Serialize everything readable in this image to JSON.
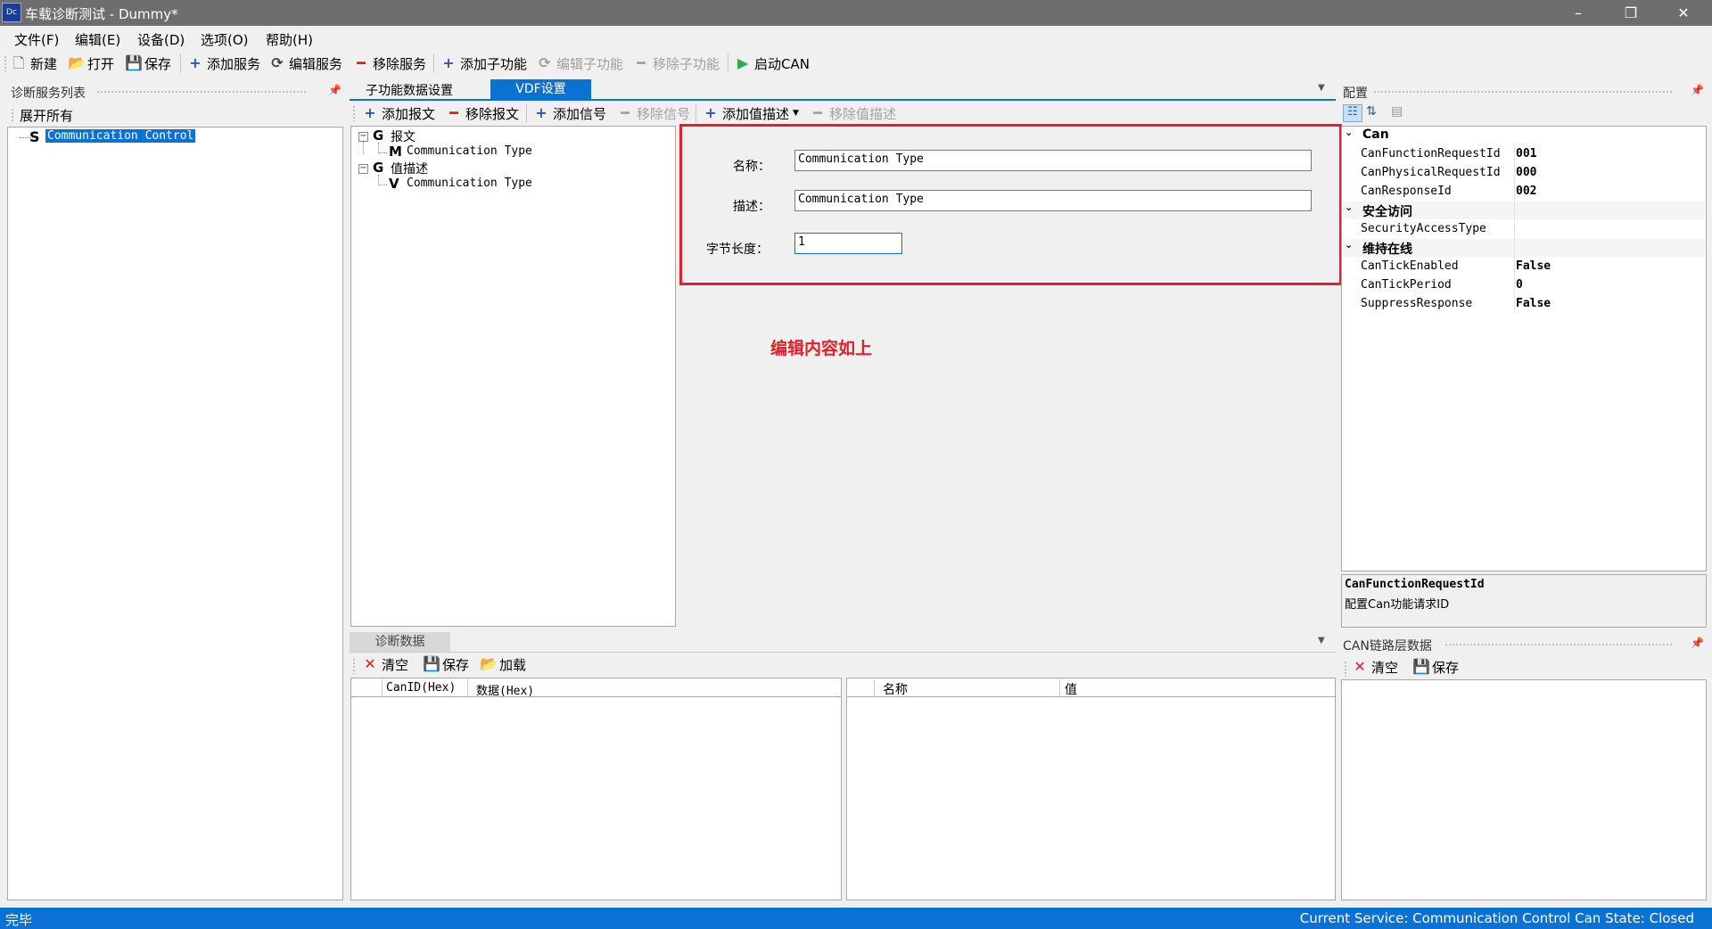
{
  "window": {
    "title": "车载诊断测试 - Dummy*",
    "icon_label": "Dc",
    "minimize": "–",
    "restore": "❐",
    "close": "✕"
  },
  "menu": [
    "文件(F)",
    "编辑(E)",
    "设备(D)",
    "选项(O)",
    "帮助(H)"
  ],
  "toolbar": {
    "new": "新建",
    "open": "打开",
    "save": "保存",
    "add_service": "添加服务",
    "edit_service": "编辑服务",
    "remove_service": "移除服务",
    "add_subfunc": "添加子功能",
    "edit_subfunc": "编辑子功能",
    "remove_subfunc": "移除子功能",
    "start_can": "启动CAN"
  },
  "left_panel": {
    "title": "诊断服务列表",
    "expand_all": "展开所有",
    "tree_item_prefix": "S",
    "tree_item": "Communication Control"
  },
  "tabs": {
    "tab1": "子功能数据设置",
    "tab2": "VDF设置"
  },
  "subtoolbar": {
    "add_msg": "添加报文",
    "remove_msg": "移除报文",
    "add_signal": "添加信号",
    "remove_signal": "移除信号",
    "add_valdesc": "添加值描述",
    "remove_valdesc": "移除值描述"
  },
  "vdf_tree": {
    "g1_prefix": "G",
    "g1": "报文",
    "m_prefix": "M",
    "m": "Communication Type",
    "g2_prefix": "G",
    "g2": "值描述",
    "v_prefix": "V",
    "v": "Communication Type"
  },
  "form": {
    "name_label": "名称：",
    "name_value": "Communication Type",
    "desc_label": "描述：",
    "desc_value": "Communication Type",
    "len_label": "字节长度：",
    "len_value": "1"
  },
  "annotation": "编辑内容如上",
  "config": {
    "title": "配置",
    "cat_can": "Can",
    "can_rows": [
      {
        "name": "CanFunctionRequestId",
        "value": "001"
      },
      {
        "name": "CanPhysicalRequestId",
        "value": "000"
      },
      {
        "name": "CanResponseId",
        "value": "002"
      }
    ],
    "cat_security": "安全访问",
    "security_rows": [
      {
        "name": "SecurityAccessType",
        "value": ""
      }
    ],
    "cat_keepalive": "维持在线",
    "keepalive_rows": [
      {
        "name": "CanTickEnabled",
        "value": "False"
      },
      {
        "name": "CanTickPeriod",
        "value": "0"
      },
      {
        "name": "SuppressResponse",
        "value": "False"
      }
    ],
    "desc_title": "CanFunctionRequestId",
    "desc_text": "配置Can功能请求ID"
  },
  "diag_data": {
    "title": "诊断数据",
    "clear": "清空",
    "save": "保存",
    "load": "加载",
    "col_canid": "CanID(Hex)",
    "col_data": "数据(Hex)",
    "col_name": "名称",
    "col_value": "值"
  },
  "can_link": {
    "title": "CAN链路层数据",
    "clear": "清空",
    "save": "保存"
  },
  "status": {
    "left": "完毕",
    "right": "Current Service: Communication Control  Can State: Closed"
  },
  "colors": {
    "accent": "#0b72d4",
    "highlight_border": "#e0202a",
    "annotation": "#e0202a",
    "start_green": "#22b14c",
    "remove_red": "#d81e1e"
  }
}
